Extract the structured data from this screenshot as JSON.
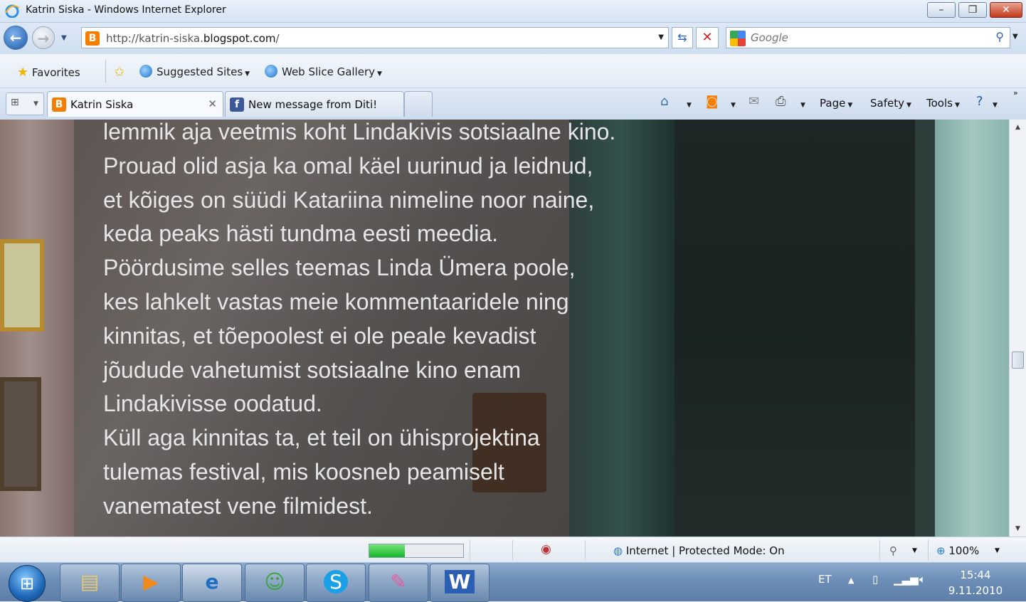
{
  "window": {
    "title": "Katrin Siska - Windows Internet Explorer"
  },
  "address": {
    "url_prefix": "http://katrin-siska.",
    "url_domain": "blogspot.com",
    "url_suffix": "/"
  },
  "search": {
    "placeholder": "Google"
  },
  "favorites": {
    "favorites_label": "Favorites",
    "suggested_sites": "Suggested Sites",
    "web_slice_gallery": "Web Slice Gallery"
  },
  "tabs": [
    {
      "label": "Katrin Siska",
      "icon": "blogger-icon"
    },
    {
      "label": "New message from Diti!",
      "icon": "facebook-icon"
    }
  ],
  "commands": {
    "page": "Page",
    "safety": "Safety",
    "tools": "Tools"
  },
  "article": {
    "lines": [
      "lemmik aja veetmis koht Lindakivis sotsiaalne kino.",
      "Prouad olid asja ka omal käel uurinud ja leidnud,",
      "et kõiges on süüdi Katariina nimeline noor naine,",
      "keda peaks hästi tundma eesti meedia.",
      "Pöördusime selles teemas Linda Ümera poole,",
      "kes lahkelt vastas meie kommentaaridele ning",
      "kinnitas, et tõepoolest ei ole peale kevadist",
      "jõudude vahetumist sotsiaalne kino enam",
      "Lindakivisse oodatud.",
      "Küll aga kinnitas ta, et teil on ühisprojektina",
      "tulemas festival, mis koosneb peamiselt",
      "vanematest vene filmidest."
    ]
  },
  "status": {
    "zone": "Internet | Protected Mode: On",
    "zoom": "100%",
    "progress_fraction": 0.38
  },
  "taskbar": {
    "apps": [
      "explorer-icon",
      "media-player-icon",
      "internet-explorer-icon",
      "messenger-icon",
      "skype-icon",
      "paint-icon",
      "word-icon"
    ],
    "language": "ET",
    "time": "15:44",
    "date": "9.11.2010"
  },
  "colors": {
    "accent": "#1f5aa8",
    "progress": "#15b52a",
    "close": "#c2391d"
  }
}
